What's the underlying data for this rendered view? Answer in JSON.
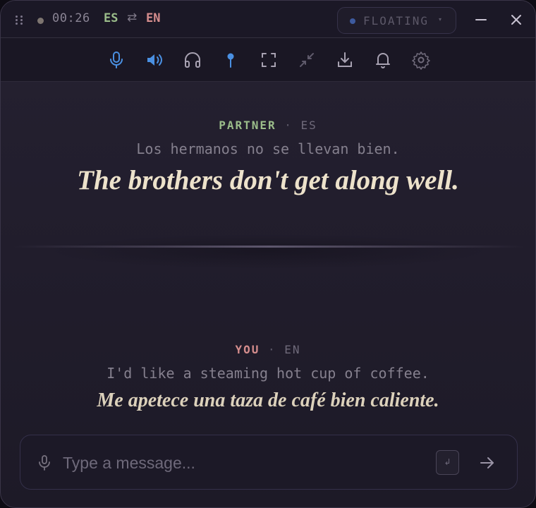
{
  "titlebar": {
    "timer": "00:26",
    "source_lang": "ES",
    "swap_icon": "⇄",
    "target_lang": "EN",
    "mode": {
      "label": "FLOATING",
      "caret": "▾"
    }
  },
  "toolbar": {
    "icons": [
      "microphone-icon",
      "speaker-icon",
      "headphones-icon",
      "pin-icon",
      "expand-icon",
      "collapse-icon",
      "download-icon",
      "bell-icon",
      "gear-icon"
    ]
  },
  "partner": {
    "name": "PARTNER",
    "separator": "·",
    "lang": "ES",
    "original": "Los hermanos no se llevan bien.",
    "translation": "The brothers don't get along well."
  },
  "you": {
    "name": "YOU",
    "separator": "·",
    "lang": "EN",
    "original": "I'd like a steaming hot cup of coffee.",
    "translation": "Me apetece una taza de café bien caliente."
  },
  "composer": {
    "value": "",
    "placeholder": "Type a message...",
    "enter_hint": "↲"
  },
  "colors": {
    "accent_blue": "#4a90e2",
    "source_lang_green": "#9bbd8a",
    "target_lang_red": "#d58d8d",
    "translation_cream": "#ede2cb"
  }
}
